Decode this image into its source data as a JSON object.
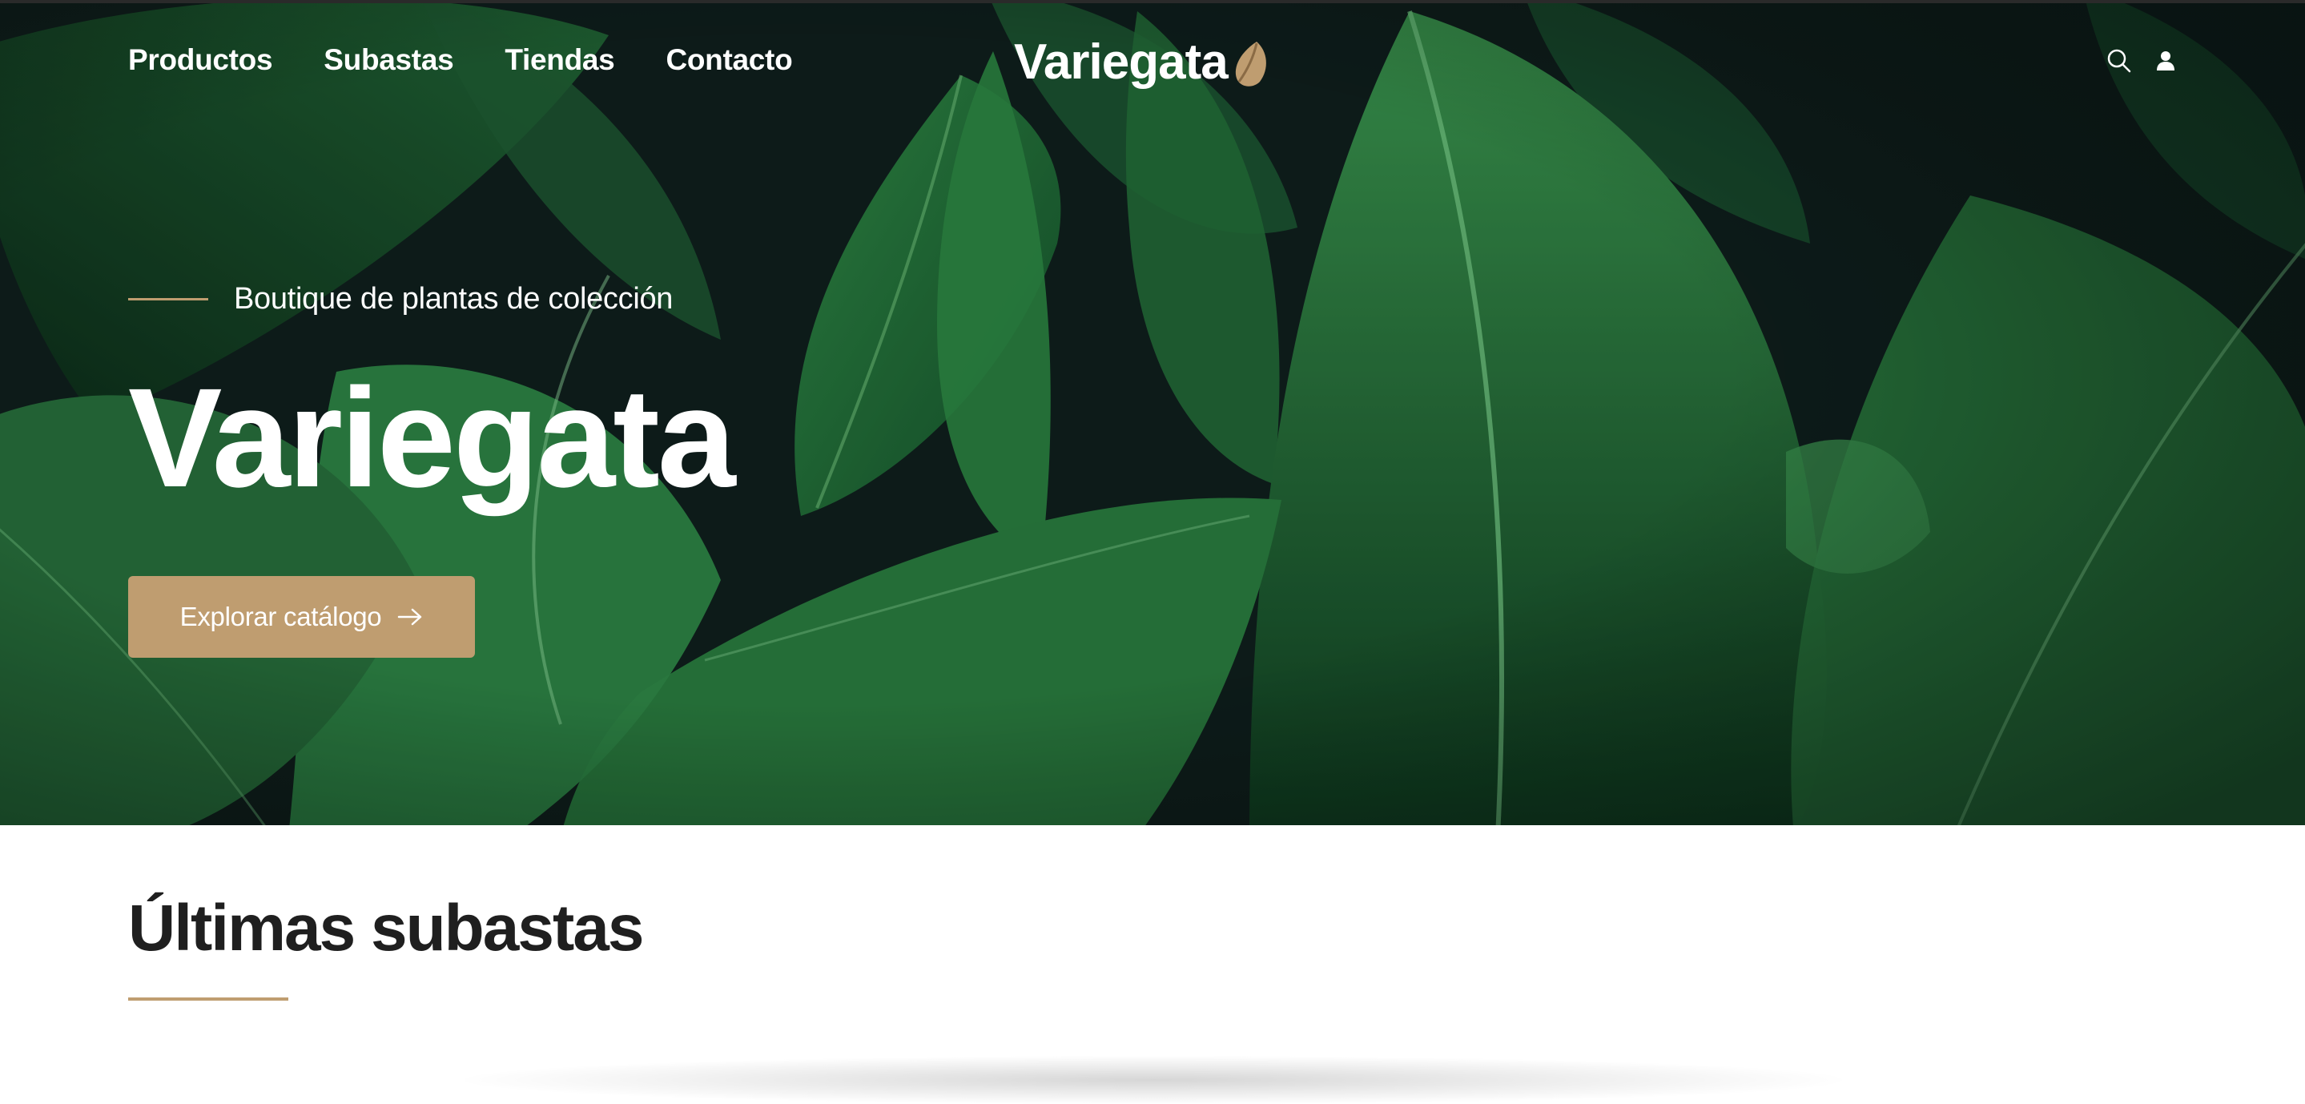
{
  "nav": {
    "items": [
      {
        "label": "Productos"
      },
      {
        "label": "Subastas"
      },
      {
        "label": "Tiendas"
      },
      {
        "label": "Contacto"
      }
    ]
  },
  "brand": {
    "name": "Variegata",
    "logo_icon": "leaf-icon"
  },
  "header_icons": {
    "search": "search-icon",
    "account": "user-icon"
  },
  "hero": {
    "tagline": "Boutique de plantas de colección",
    "title": "Variegata",
    "cta_label": "Explorar catálogo",
    "cta_icon": "arrow-right-icon"
  },
  "section": {
    "title": "Últimas subastas"
  },
  "colors": {
    "accent": "#bf9d70",
    "hero_background": "#10201a",
    "text_dark": "#1f1f1f"
  }
}
